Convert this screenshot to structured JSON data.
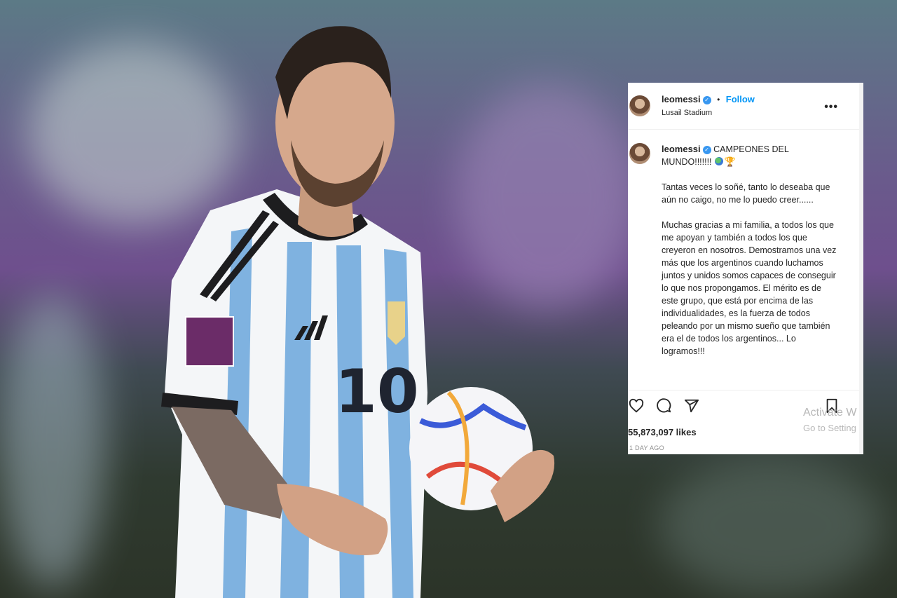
{
  "post": {
    "username": "leomessi",
    "follow_label": "Follow",
    "location": "Lusail Stadium",
    "caption": {
      "headline": "CAMPEONES DEL MUNDO!!!!!!!",
      "paragraph_1": "Tantas veces lo soñé, tanto lo deseaba que aún no caigo, no me lo puedo creer......",
      "paragraph_2": "Muchas gracias a mi familia, a todos los que me apoyan y también a todos los que creyeron en nosotros. Demostramos una vez más que los argentinos cuando luchamos juntos y unidos somos capaces de conseguir lo que nos propongamos. El mérito es de este grupo, que está por encima de las individualidades, es la fuerza de todos peleando por un mismo sueño que también era el de todos los argentinos... Lo logramos!!!"
    },
    "likes": "55,873,097 likes",
    "time_ago": "1 DAY AGO"
  },
  "watermark": {
    "line1": "Activate W",
    "line2": "Go to Setting"
  },
  "icons": {
    "verified": "verified-badge-icon",
    "more": "more-options-icon",
    "like": "heart-icon",
    "comment": "comment-icon",
    "share": "share-icon",
    "save": "bookmark-icon",
    "globe": "globe-emoji-icon",
    "trophy": "trophy-emoji-icon"
  },
  "colors": {
    "link": "#0095f6",
    "verified": "#3897f0",
    "argentina_sky_blue": "#7fb2e0"
  }
}
